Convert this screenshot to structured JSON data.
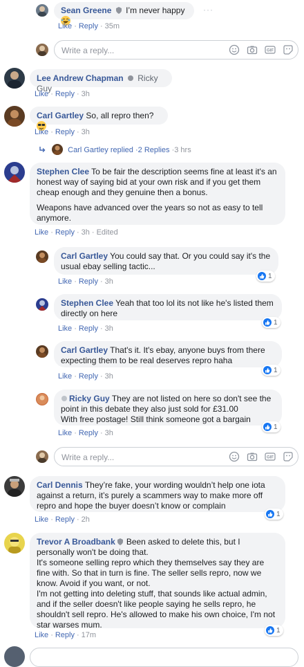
{
  "comments": [
    {
      "author": "Sean Greene",
      "text": "I’m never happy",
      "actions": [
        "Like",
        "Reply",
        "35m"
      ]
    },
    {
      "author": "Lee Andrew Chapman",
      "text": "Ricky Guy",
      "actions": [
        "Like",
        "Reply",
        "3h"
      ]
    },
    {
      "author": "Carl Gartley",
      "text": "So, all repro then?",
      "actions": [
        "Like",
        "Reply",
        "3h"
      ],
      "replies_link": {
        "author": "Carl Gartley",
        "replied": "replied",
        "count": "2 Replies",
        "time": "3 hrs"
      }
    },
    {
      "author": "Stephen Clee",
      "text": "To be fair the description seems fine at least it's an honest way of saying bid at your own risk and if you get them cheap enough and they genuine then a bonus.",
      "text2": "Weapons have advanced over the years so not as easy to tell anymore.",
      "actions": [
        "Like",
        "Reply",
        "3h",
        "Edited"
      ]
    },
    {
      "author": "Carl Dennis",
      "text": "They’re fake, your wording wouldn’t help one iota against a return, it’s purely a scammers way to make more off repro and hope the buyer doesn’t know or complain",
      "actions": [
        "Like",
        "Reply",
        "2h"
      ],
      "reactions": "1"
    },
    {
      "author": "Trevor A Broadbank",
      "text": "Been asked to delete this, but I personally won't be doing that.",
      "text2": "It's someone selling repro which they themselves say they are fine with. So that in turn is fine. The seller sells repro, now we know. Avoid if you want, or not.",
      "text3": "I'm not getting into deleting stuff, that sounds like actual admin, and if the seller doesn't like people saying he sells repro, he shouldn't sell repro. He's allowed to make his own choice, I'm not star warses mum.",
      "actions": [
        "Like",
        "Reply",
        "17m"
      ],
      "reactions": "1"
    }
  ],
  "replies": [
    {
      "author": "Carl Gartley",
      "text": "You could say that. Or you could say it's the usual ebay selling tactic...",
      "actions": [
        "Like",
        "Reply",
        "3h"
      ],
      "reactions": "1"
    },
    {
      "author": "Stephen Clee",
      "text": "Yeah that too lol its not like he's listed them directly on here",
      "actions": [
        "Like",
        "Reply",
        "3h"
      ],
      "reactions": "1"
    },
    {
      "author": "Carl Gartley",
      "text": "That's it. It's ebay, anyone buys from there expecting them to be real deserves repro haha",
      "actions": [
        "Like",
        "Reply",
        "3h"
      ],
      "reactions": "1"
    },
    {
      "author": "Ricky Guy",
      "text": "They are not listed on here so don't see the point in this debate they also just sold for £31.00",
      "text2": "With free postage! Still think someone got a bargain",
      "actions": [
        "Like",
        "Reply",
        "3h"
      ],
      "reactions": "1"
    }
  ],
  "reply_box": {
    "placeholder": "Write a reply...",
    "icons": [
      "emoji-icon",
      "camera-icon",
      "gif-icon",
      "sticker-icon"
    ]
  },
  "more_options": "···",
  "colors": {
    "link": "#385898",
    "action": "#4267b2",
    "bubble": "#f2f3f5",
    "meta": "#90949c",
    "like": "#1877f2"
  }
}
